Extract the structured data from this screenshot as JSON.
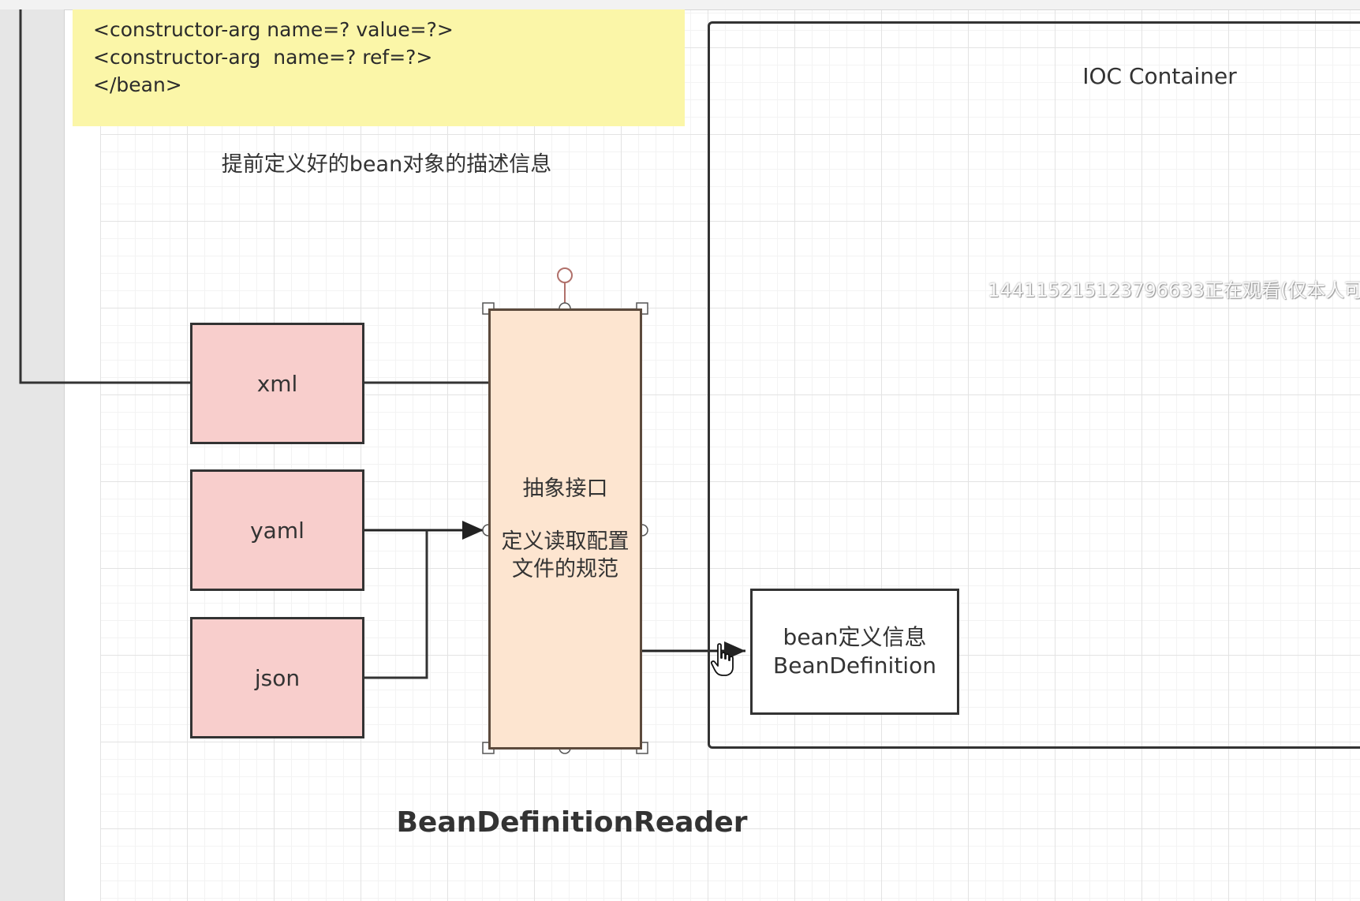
{
  "diagram": {
    "code_note": {
      "lines": [
        "<constructor-arg name=? value=?>",
        "<constructor-arg  name=? ref=?>",
        "</bean>"
      ]
    },
    "caption": "提前定义好的bean对象的描述信息",
    "sources": [
      {
        "id": "xml",
        "label": "xml"
      },
      {
        "id": "yaml",
        "label": "yaml"
      },
      {
        "id": "json",
        "label": "json"
      }
    ],
    "reader": {
      "title": "抽象接口",
      "description": "定义读取配置文件的规范",
      "name": "BeanDefinitionReader"
    },
    "container": {
      "title": "IOC  Container",
      "bean_definition": {
        "line1": "bean定义信息",
        "line2": "BeanDefinition"
      }
    },
    "watermark": "14411521512379663​3正在观看(仅本人可"
  },
  "colors": {
    "note_fill": "#fbf6a8",
    "source_fill": "#f8cecc",
    "reader_fill": "#fde5d0",
    "line": "#333333"
  }
}
